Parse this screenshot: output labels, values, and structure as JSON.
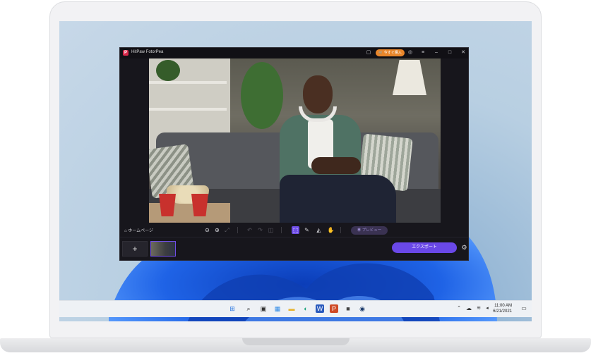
{
  "app": {
    "title": "HitPaw FotorPea",
    "buy_label": "今すぐ購入",
    "home_label": "ホームページ",
    "preview_label": "プレビュー",
    "export_label": "エクスポート",
    "add_label": "+"
  },
  "titlebar_icons": [
    "chat-icon",
    "cart-icon",
    "user-icon",
    "menu-icon",
    "minimize-icon",
    "maximize-icon",
    "close-icon"
  ],
  "toolbar_icons": [
    "zoom-out-icon",
    "zoom-in-icon",
    "fit-icon",
    "undo-icon",
    "redo-icon",
    "compare-icon",
    "select-icon",
    "brush-icon",
    "eraser-icon",
    "hand-icon"
  ],
  "taskbar": {
    "time": "11:00 AM",
    "date": "6/21/2021",
    "apps": [
      "start-icon",
      "search-icon",
      "task-view-icon",
      "widgets-icon",
      "file-explorer-icon",
      "edge-icon",
      "word-icon",
      "powerpoint-icon",
      "store-icon",
      "steam-icon"
    ],
    "tray": [
      "chevron-up-icon",
      "cloud-icon",
      "wifi-icon",
      "volume-icon",
      "notification-icon"
    ]
  },
  "colors": {
    "accent": "#6a48e8",
    "buy": "#e9862a",
    "bloom": "#1f5fe0"
  }
}
